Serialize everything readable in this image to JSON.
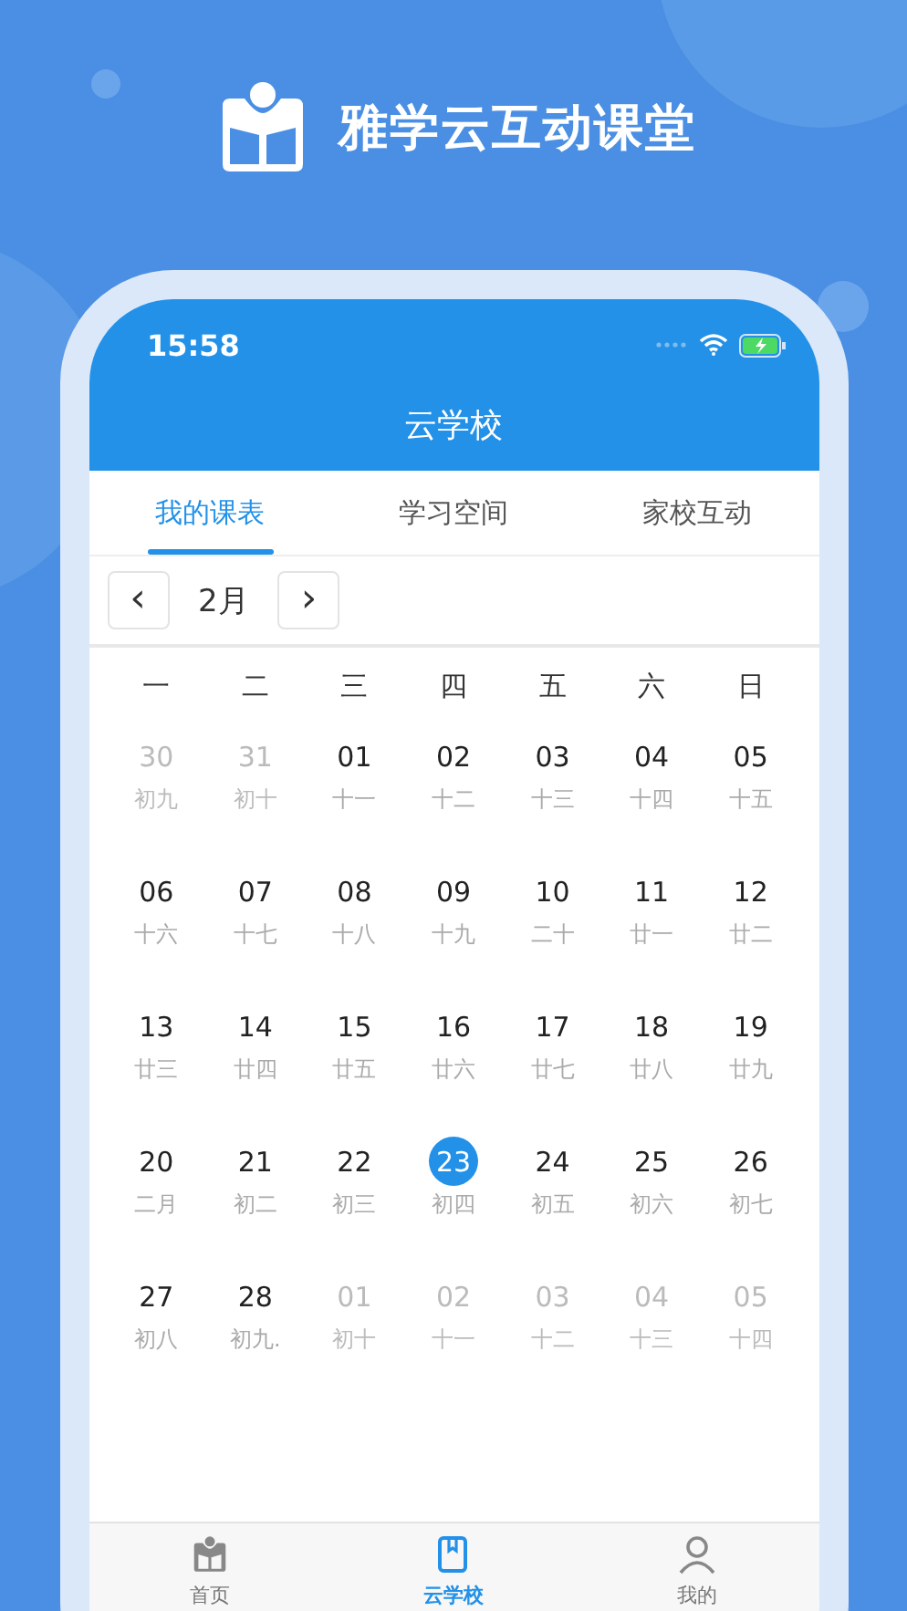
{
  "app_title": "雅学云互动课堂",
  "status_bar": {
    "time": "15:58"
  },
  "header": {
    "title": "云学校"
  },
  "tabs": [
    {
      "label": "我的课表",
      "selected": true
    },
    {
      "label": "学习空间",
      "selected": false
    },
    {
      "label": "家校互动",
      "selected": false
    }
  ],
  "month_nav": {
    "prev": "‹",
    "month": "2月",
    "next": "›"
  },
  "weekdays": [
    "一",
    "二",
    "三",
    "四",
    "五",
    "六",
    "日"
  ],
  "days": [
    {
      "day": "30",
      "lunar": "初九",
      "in_month": false,
      "selected": false
    },
    {
      "day": "31",
      "lunar": "初十",
      "in_month": false,
      "selected": false
    },
    {
      "day": "01",
      "lunar": "十一",
      "in_month": true,
      "selected": false
    },
    {
      "day": "02",
      "lunar": "十二",
      "in_month": true,
      "selected": false
    },
    {
      "day": "03",
      "lunar": "十三",
      "in_month": true,
      "selected": false
    },
    {
      "day": "04",
      "lunar": "十四",
      "in_month": true,
      "selected": false
    },
    {
      "day": "05",
      "lunar": "十五",
      "in_month": true,
      "selected": false
    },
    {
      "day": "06",
      "lunar": "十六",
      "in_month": true,
      "selected": false
    },
    {
      "day": "07",
      "lunar": "十七",
      "in_month": true,
      "selected": false
    },
    {
      "day": "08",
      "lunar": "十八",
      "in_month": true,
      "selected": false
    },
    {
      "day": "09",
      "lunar": "十九",
      "in_month": true,
      "selected": false
    },
    {
      "day": "10",
      "lunar": "二十",
      "in_month": true,
      "selected": false
    },
    {
      "day": "11",
      "lunar": "廿一",
      "in_month": true,
      "selected": false
    },
    {
      "day": "12",
      "lunar": "廿二",
      "in_month": true,
      "selected": false
    },
    {
      "day": "13",
      "lunar": "廿三",
      "in_month": true,
      "selected": false
    },
    {
      "day": "14",
      "lunar": "廿四",
      "in_month": true,
      "selected": false
    },
    {
      "day": "15",
      "lunar": "廿五",
      "in_month": true,
      "selected": false
    },
    {
      "day": "16",
      "lunar": "廿六",
      "in_month": true,
      "selected": false
    },
    {
      "day": "17",
      "lunar": "廿七",
      "in_month": true,
      "selected": false
    },
    {
      "day": "18",
      "lunar": "廿八",
      "in_month": true,
      "selected": false
    },
    {
      "day": "19",
      "lunar": "廿九",
      "in_month": true,
      "selected": false
    },
    {
      "day": "20",
      "lunar": "二月",
      "in_month": true,
      "selected": false
    },
    {
      "day": "21",
      "lunar": "初二",
      "in_month": true,
      "selected": false
    },
    {
      "day": "22",
      "lunar": "初三",
      "in_month": true,
      "selected": false
    },
    {
      "day": "23",
      "lunar": "初四",
      "in_month": true,
      "selected": true
    },
    {
      "day": "24",
      "lunar": "初五",
      "in_month": true,
      "selected": false
    },
    {
      "day": "25",
      "lunar": "初六",
      "in_month": true,
      "selected": false
    },
    {
      "day": "26",
      "lunar": "初七",
      "in_month": true,
      "selected": false
    },
    {
      "day": "27",
      "lunar": "初八",
      "in_month": true,
      "selected": false
    },
    {
      "day": "28",
      "lunar": "初九.",
      "in_month": true,
      "selected": false
    },
    {
      "day": "01",
      "lunar": "初十",
      "in_month": false,
      "selected": false
    },
    {
      "day": "02",
      "lunar": "十一",
      "in_month": false,
      "selected": false
    },
    {
      "day": "03",
      "lunar": "十二",
      "in_month": false,
      "selected": false
    },
    {
      "day": "04",
      "lunar": "十三",
      "in_month": false,
      "selected": false
    },
    {
      "day": "05",
      "lunar": "十四",
      "in_month": false,
      "selected": false
    }
  ],
  "bottom_nav": [
    {
      "kind": "home",
      "label": "首页",
      "selected": false
    },
    {
      "kind": "school",
      "label": "云学校",
      "selected": true
    },
    {
      "kind": "profile",
      "label": "我的",
      "selected": false
    }
  ]
}
